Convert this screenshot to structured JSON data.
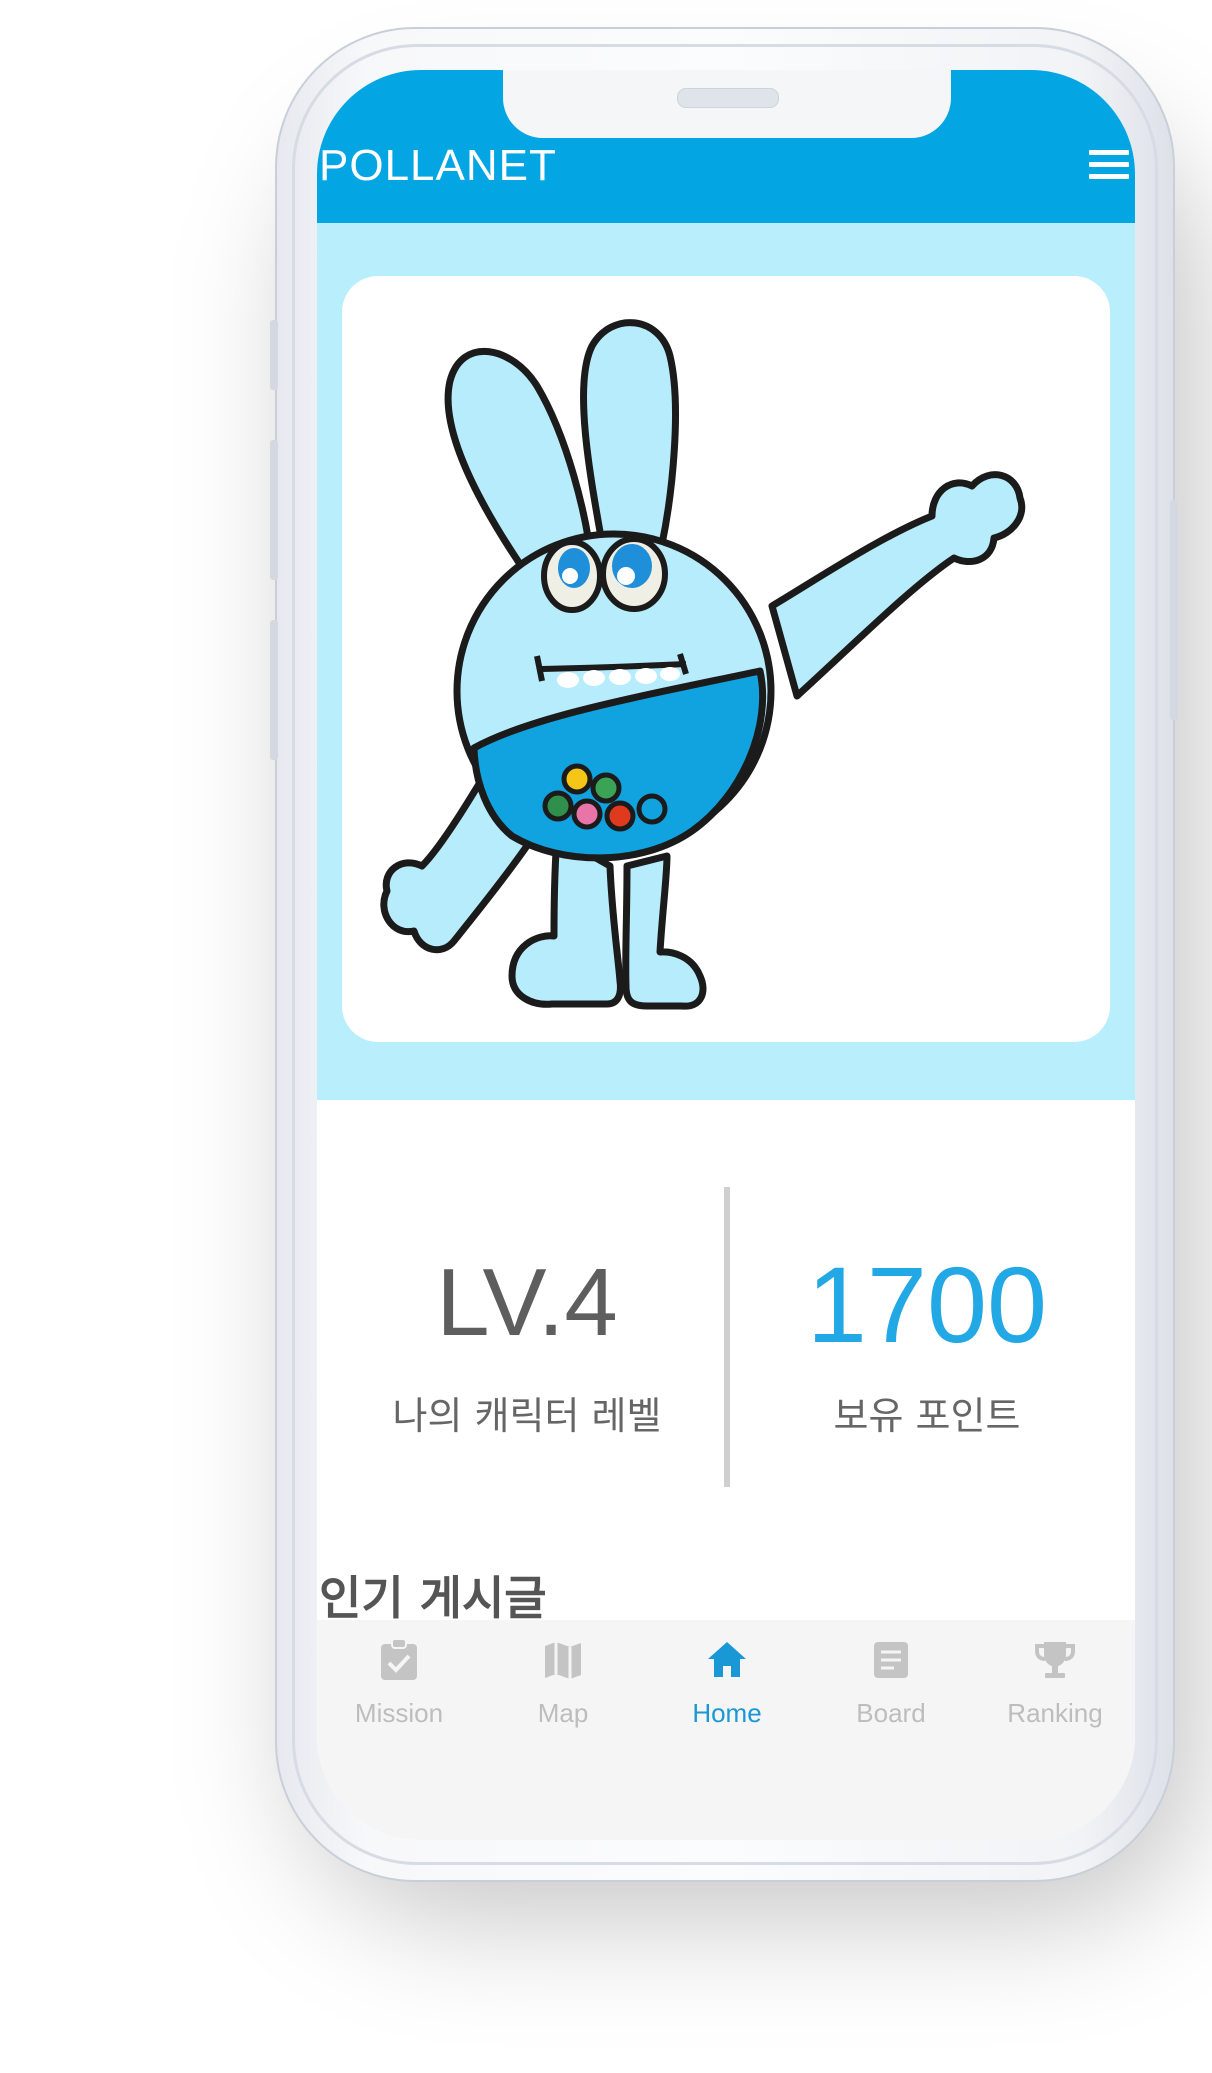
{
  "app": {
    "title": "POLLANET",
    "menu_icon": "hamburger-menu-icon",
    "brand_color": "#03a6e3",
    "hero_bg": "#b9effc"
  },
  "stats": {
    "level_value": "LV.4",
    "level_label": "나의 캐릭터 레벨",
    "points_value": "1700",
    "points_label": "보유 포인트",
    "points_color": "#22a8e5"
  },
  "section": {
    "title": "인기 게시글"
  },
  "tabs": [
    {
      "label": "Mission",
      "icon": "clipboard-check-icon",
      "active": false
    },
    {
      "label": "Map",
      "icon": "map-icon",
      "active": false
    },
    {
      "label": "Home",
      "icon": "home-icon",
      "active": true
    },
    {
      "label": "Board",
      "icon": "document-icon",
      "active": false
    },
    {
      "label": "Ranking",
      "icon": "trophy-icon",
      "active": false
    }
  ],
  "colors": {
    "tab_inactive": "#bdbdbd",
    "tab_active": "#1a98d5"
  }
}
